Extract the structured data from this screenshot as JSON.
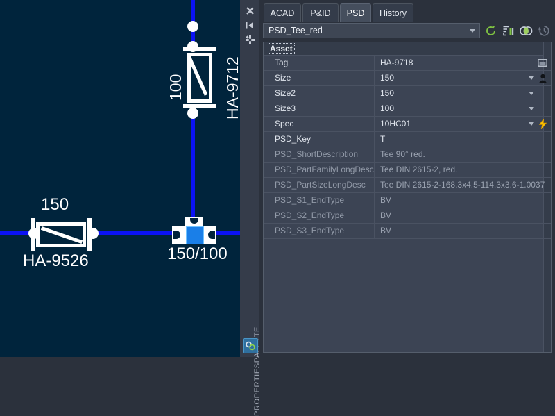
{
  "drawing": {
    "background_color": "#00243c",
    "pipe_color": "#0b12f5",
    "symbol_color": "#ffffff",
    "selection_color": "#1a7fe8",
    "labels": {
      "valve_vertical_size": "100",
      "valve_vertical_tag": "HA-9712",
      "valve_horizontal_size": "150",
      "valve_horizontal_tag": "HA-9526",
      "tee_size": "150/100"
    }
  },
  "dock": {
    "title": "PROPERTIESPALETTE",
    "close_label": "✕",
    "autohide_label": "▐◀",
    "options_label": "✱",
    "bottom_icon": "gears-icon"
  },
  "panel": {
    "tabs": [
      {
        "label": "ACAD",
        "active": false
      },
      {
        "label": "P&ID",
        "active": false
      },
      {
        "label": "PSD",
        "active": true
      },
      {
        "label": "History",
        "active": false
      }
    ],
    "selection": {
      "value": "PSD_Tee_red",
      "dropdown_icon": "chevron-down-icon"
    },
    "toolbar_icons": [
      {
        "name": "refresh-icon",
        "color": "#7ec142"
      },
      {
        "name": "quick-select-icon",
        "color": "#7ec142"
      },
      {
        "name": "select-similar-icon",
        "color": "#c9d1dd"
      },
      {
        "name": "history-icon",
        "color": "#6f7786"
      }
    ],
    "group_header": "Asset",
    "rows": [
      {
        "key": "Tag",
        "value": "HA-9718",
        "readonly": false,
        "dropdown": false,
        "icon": "window-icon"
      },
      {
        "key": "Size",
        "value": "150",
        "readonly": false,
        "dropdown": true,
        "icon": "person-icon"
      },
      {
        "key": "Size2",
        "value": "150",
        "readonly": false,
        "dropdown": true,
        "icon": ""
      },
      {
        "key": "Size3",
        "value": "100",
        "readonly": false,
        "dropdown": true,
        "icon": ""
      },
      {
        "key": "Spec",
        "value": "10HC01",
        "readonly": false,
        "dropdown": true,
        "icon": "lightning-icon"
      },
      {
        "key": "PSD_Key",
        "value": "T",
        "readonly": false,
        "dropdown": false,
        "icon": ""
      },
      {
        "key": "PSD_ShortDescription",
        "value": "Tee 90° red.",
        "readonly": true,
        "dropdown": false,
        "icon": ""
      },
      {
        "key": "PSD_PartFamilyLongDesc",
        "value": "Tee DIN 2615-2, red.",
        "readonly": true,
        "dropdown": false,
        "icon": ""
      },
      {
        "key": "PSD_PartSizeLongDesc",
        "value": "Tee DIN 2615-2-168.3x4.5-114.3x3.6-1.0037",
        "readonly": true,
        "dropdown": false,
        "icon": ""
      },
      {
        "key": "PSD_S1_EndType",
        "value": "BV",
        "readonly": true,
        "dropdown": false,
        "icon": ""
      },
      {
        "key": "PSD_S2_EndType",
        "value": "BV",
        "readonly": true,
        "dropdown": false,
        "icon": ""
      },
      {
        "key": "PSD_S3_EndType",
        "value": "BV",
        "readonly": true,
        "dropdown": false,
        "icon": ""
      }
    ]
  }
}
